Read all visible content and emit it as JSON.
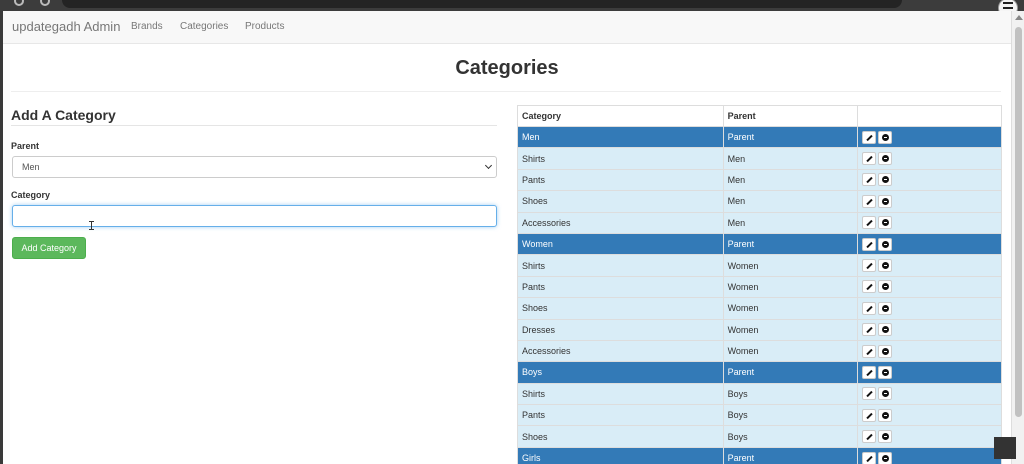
{
  "navbar": {
    "brand": "updategadh Admin",
    "links": [
      "Brands",
      "Categories",
      "Products"
    ]
  },
  "page": {
    "title": "Categories"
  },
  "form": {
    "heading": "Add A Category",
    "parent_label": "Parent",
    "parent_selected": "Men",
    "category_label": "Category",
    "category_value": "",
    "submit_label": "Add Category"
  },
  "table": {
    "headers": [
      "Category",
      "Parent",
      ""
    ],
    "rows": [
      {
        "category": "Men",
        "parent": "Parent",
        "is_parent": true
      },
      {
        "category": "Shirts",
        "parent": "Men",
        "is_parent": false
      },
      {
        "category": "Pants",
        "parent": "Men",
        "is_parent": false
      },
      {
        "category": "Shoes",
        "parent": "Men",
        "is_parent": false
      },
      {
        "category": "Accessories",
        "parent": "Men",
        "is_parent": false
      },
      {
        "category": "Women",
        "parent": "Parent",
        "is_parent": true
      },
      {
        "category": "Shirts",
        "parent": "Women",
        "is_parent": false
      },
      {
        "category": "Pants",
        "parent": "Women",
        "is_parent": false
      },
      {
        "category": "Shoes",
        "parent": "Women",
        "is_parent": false
      },
      {
        "category": "Dresses",
        "parent": "Women",
        "is_parent": false
      },
      {
        "category": "Accessories",
        "parent": "Women",
        "is_parent": false
      },
      {
        "category": "Boys",
        "parent": "Parent",
        "is_parent": true
      },
      {
        "category": "Shirts",
        "parent": "Boys",
        "is_parent": false
      },
      {
        "category": "Pants",
        "parent": "Boys",
        "is_parent": false
      },
      {
        "category": "Shoes",
        "parent": "Boys",
        "is_parent": false
      },
      {
        "category": "Girls",
        "parent": "Parent",
        "is_parent": true
      }
    ],
    "action_icons": [
      "pencil-icon",
      "remove-icon"
    ]
  },
  "colors": {
    "parent_row": "#337ab7",
    "child_row": "#d9edf7",
    "success_button": "#5cb85c"
  }
}
